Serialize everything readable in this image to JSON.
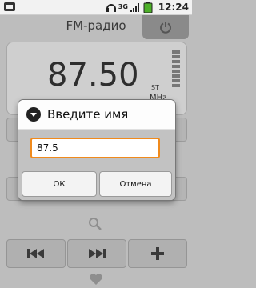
{
  "status_bar": {
    "network": "3G",
    "time": "12:24"
  },
  "app": {
    "title": "FM-радио",
    "frequency": "87.50",
    "stereo": "ST",
    "unit": "MHz"
  },
  "dialog": {
    "title": "Введите имя",
    "input_value": "87.5",
    "ok_label": "ОК",
    "cancel_label": "Отмена"
  },
  "colors": {
    "input_focus": "#f08a1c"
  }
}
